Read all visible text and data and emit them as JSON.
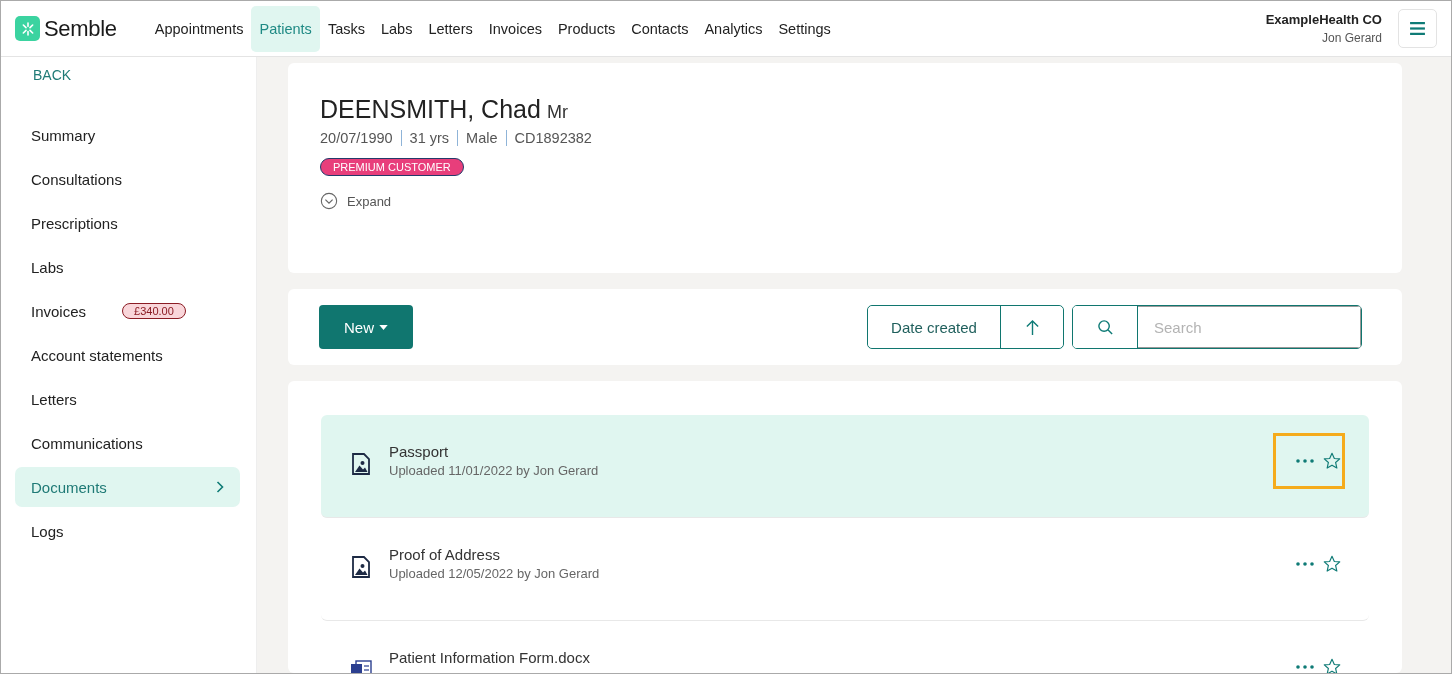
{
  "brand": "Semble",
  "nav": [
    {
      "label": "Appointments",
      "selected": false
    },
    {
      "label": "Patients",
      "selected": true
    },
    {
      "label": "Tasks",
      "selected": false
    },
    {
      "label": "Labs",
      "selected": false
    },
    {
      "label": "Letters",
      "selected": false
    },
    {
      "label": "Invoices",
      "selected": false
    },
    {
      "label": "Products",
      "selected": false
    },
    {
      "label": "Contacts",
      "selected": false
    },
    {
      "label": "Analytics",
      "selected": false
    },
    {
      "label": "Settings",
      "selected": false
    }
  ],
  "account": {
    "org": "ExampleHealth CO",
    "user": "Jon Gerard"
  },
  "sidebar": {
    "back": "BACK",
    "items": [
      {
        "label": "Summary",
        "selected": false
      },
      {
        "label": "Consultations",
        "selected": false
      },
      {
        "label": "Prescriptions",
        "selected": false
      },
      {
        "label": "Labs",
        "selected": false
      },
      {
        "label": "Invoices",
        "selected": false,
        "badge": "£340.00"
      },
      {
        "label": "Account statements",
        "selected": false
      },
      {
        "label": "Letters",
        "selected": false
      },
      {
        "label": "Communications",
        "selected": false
      },
      {
        "label": "Documents",
        "selected": true
      },
      {
        "label": "Logs",
        "selected": false
      }
    ]
  },
  "patient": {
    "name": "DEENSMITH, Chad",
    "title": "Mr",
    "details": [
      "20/07/1990",
      "31 yrs",
      "Male",
      "CD1892382"
    ],
    "tag": "PREMIUM CUSTOMER",
    "expand": "Expand"
  },
  "toolbar": {
    "new_button": "New",
    "sort": "Date created",
    "search": {
      "placeholder": "Search"
    }
  },
  "documents": [
    {
      "kind": "image",
      "name": "Passport",
      "uploaded": "Uploaded 11/01/2022 by Jon Gerard",
      "selected": true,
      "highlighted": true
    },
    {
      "kind": "image",
      "name": "Proof of Address",
      "uploaded": "Uploaded 12/05/2022 by Jon Gerard",
      "selected": false,
      "highlighted": false
    },
    {
      "kind": "word",
      "name": "Patient Information Form.docx",
      "selected": false,
      "highlighted": false
    }
  ]
}
